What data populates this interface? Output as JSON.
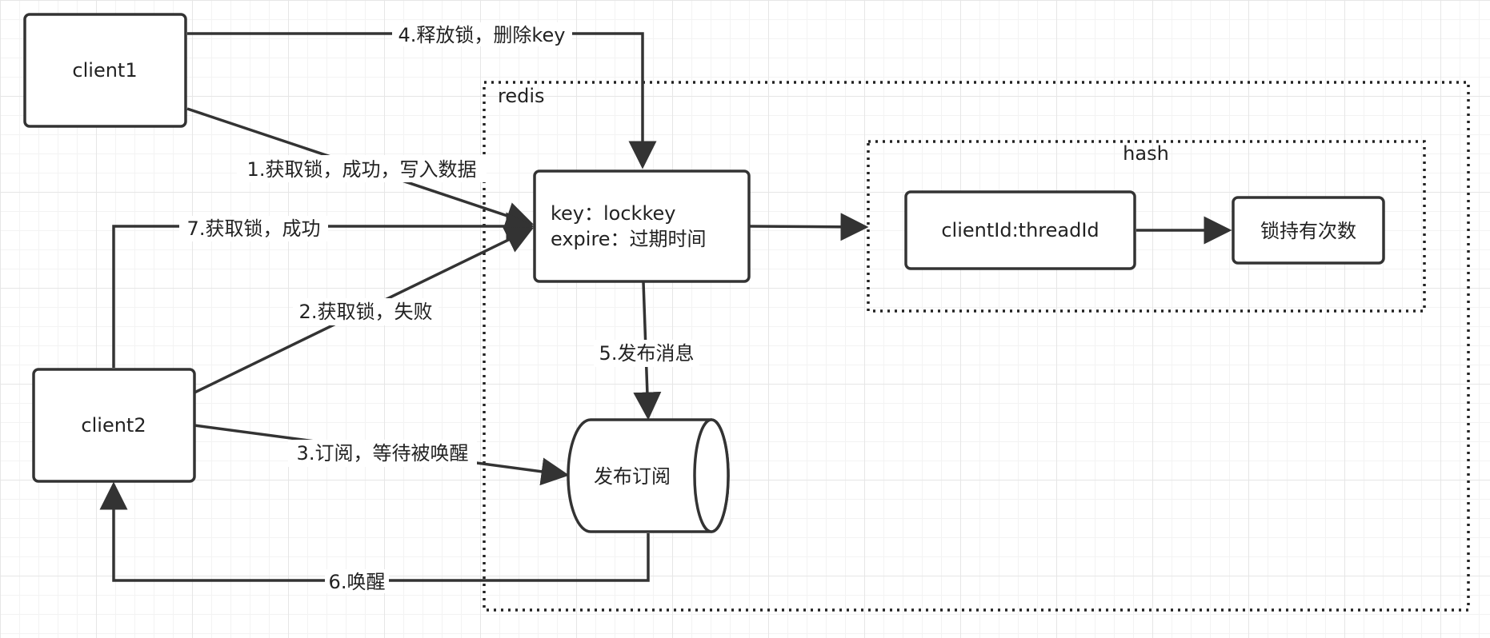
{
  "nodes": {
    "client1": "client1",
    "client2": "client2",
    "redis_label": "redis",
    "hash_label": "hash",
    "lock_key_line1": "key：lockkey",
    "lock_key_line2": "expire：过期时间",
    "client_thread": "clientId:threadId",
    "hold_count": "锁持有次数",
    "pubsub": "发布订阅"
  },
  "edges": {
    "e1": "1.获取锁，成功，写入数据",
    "e2": "2.获取锁，失败",
    "e3": "3.订阅，等待被唤醒",
    "e4": "4.释放锁，删除key",
    "e5": "5.发布消息",
    "e6": "6.唤醒",
    "e7": "7.获取锁，成功"
  },
  "colors": {
    "stroke": "#333333",
    "grid": "#e6e6e6"
  }
}
